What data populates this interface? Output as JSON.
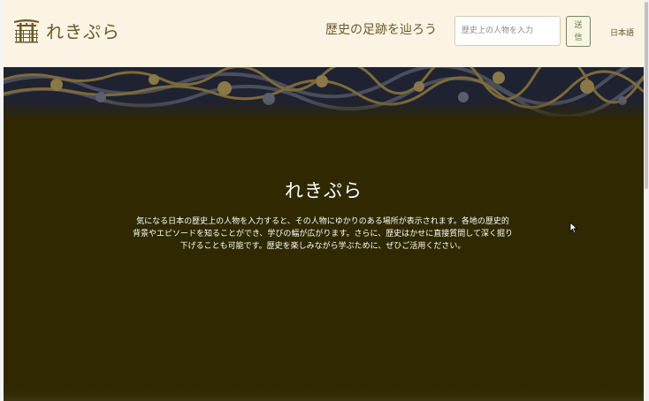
{
  "header": {
    "logo_text": "れきぷら",
    "tagline": "歴史の足跡を辿ろう",
    "search": {
      "placeholder": "歴史上の人物を入力",
      "value": ""
    },
    "send_label": "送信",
    "language": "日本語"
  },
  "hero": {
    "title": "れきぷら",
    "description": "気になる日本の歴史上の人物を入力すると、その人物にゆかりのある場所が表示されます。各地の歴史的背景やエピソードを知ることができ、学びの幅が広がります。さらに、歴史はかせに直接質問して深く掘り下げることも可能です。歴史を楽しみながら学ぶために、ぜひご活用ください。"
  },
  "colors": {
    "header_bg": "#fbf3e4",
    "brand_text": "#6b5a2a",
    "hero_bg": "#2f2800",
    "send_accent": "#5f7f43"
  },
  "icons": {
    "logo": "torii-gate-icon",
    "pointer": "mouse-cursor-icon"
  }
}
